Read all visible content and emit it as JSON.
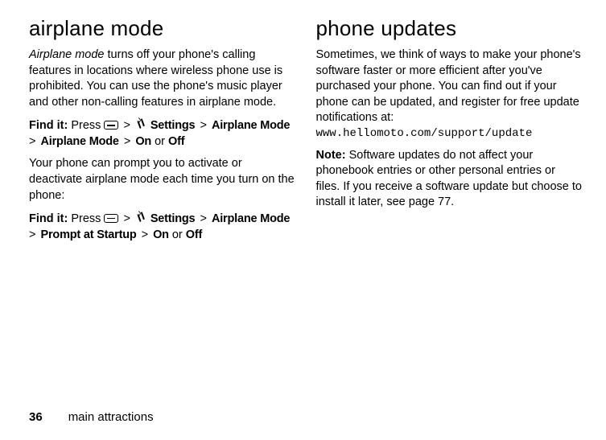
{
  "left": {
    "heading": "airplane mode",
    "intro_em": "Airplane mode",
    "intro_rest": " turns off your phone's calling features in locations where wireless phone use is prohibited. You can use the phone's music player and other non-calling features in airplane mode.",
    "find1_label": "Find it:",
    "find1_press": " Press ",
    "find1_settings": " Settings",
    "find1_am1": "Airplane Mode",
    "find1_am2": "Airplane Mode",
    "find1_on": "On",
    "find1_or": " or ",
    "find1_off": "Off",
    "gt": " > ",
    "para2": "Your phone can prompt you to activate or deactivate airplane mode each time you turn on the phone:",
    "find2_label": "Find it:",
    "find2_press": " Press ",
    "find2_settings": " Settings",
    "find2_am": "Airplane Mode",
    "find2_prompt": "Prompt at Startup",
    "find2_on": "On",
    "find2_or": " or ",
    "find2_off": "Off"
  },
  "right": {
    "heading": "phone updates",
    "para1": "Sometimes, we think of ways to make your phone's software faster or more efficient after you've purchased your phone. You can find out if your phone can be updated, and register for free update notifications at:",
    "url": "www.hellomoto.com/support/update",
    "note_label": "Note:",
    "note_rest": " Software updates do not affect your phonebook entries or other personal entries or files. If you receive a software update but choose to install it later, see page 77."
  },
  "footer": {
    "page": "36",
    "section": "main attractions"
  }
}
